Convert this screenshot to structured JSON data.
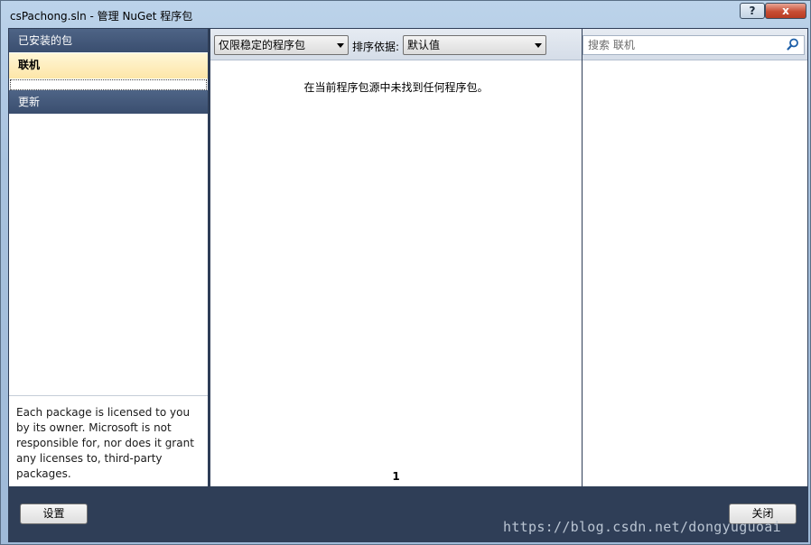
{
  "window": {
    "title": "csPachong.sln - 管理 NuGet 程序包",
    "help_label": "?",
    "close_label": "x"
  },
  "sidebar": {
    "installed_label": "已安装的包",
    "online_label": "联机",
    "updates_label": "更新",
    "license_text": "Each package is licensed to you by its owner. Microsoft is not responsible for, nor does it grant any licenses to, third-party packages."
  },
  "toolbar": {
    "filter_value": "仅限稳定的程序包",
    "sort_label": "排序依据:",
    "sort_value": "默认值"
  },
  "main": {
    "empty_message": "在当前程序包源中未找到任何程序包。",
    "page_number": "1"
  },
  "search": {
    "placeholder": "搜索 联机"
  },
  "footer": {
    "settings_label": "设置",
    "close_label": "关闭"
  },
  "watermark": "https://blog.csdn.net/dongyuguoai"
}
